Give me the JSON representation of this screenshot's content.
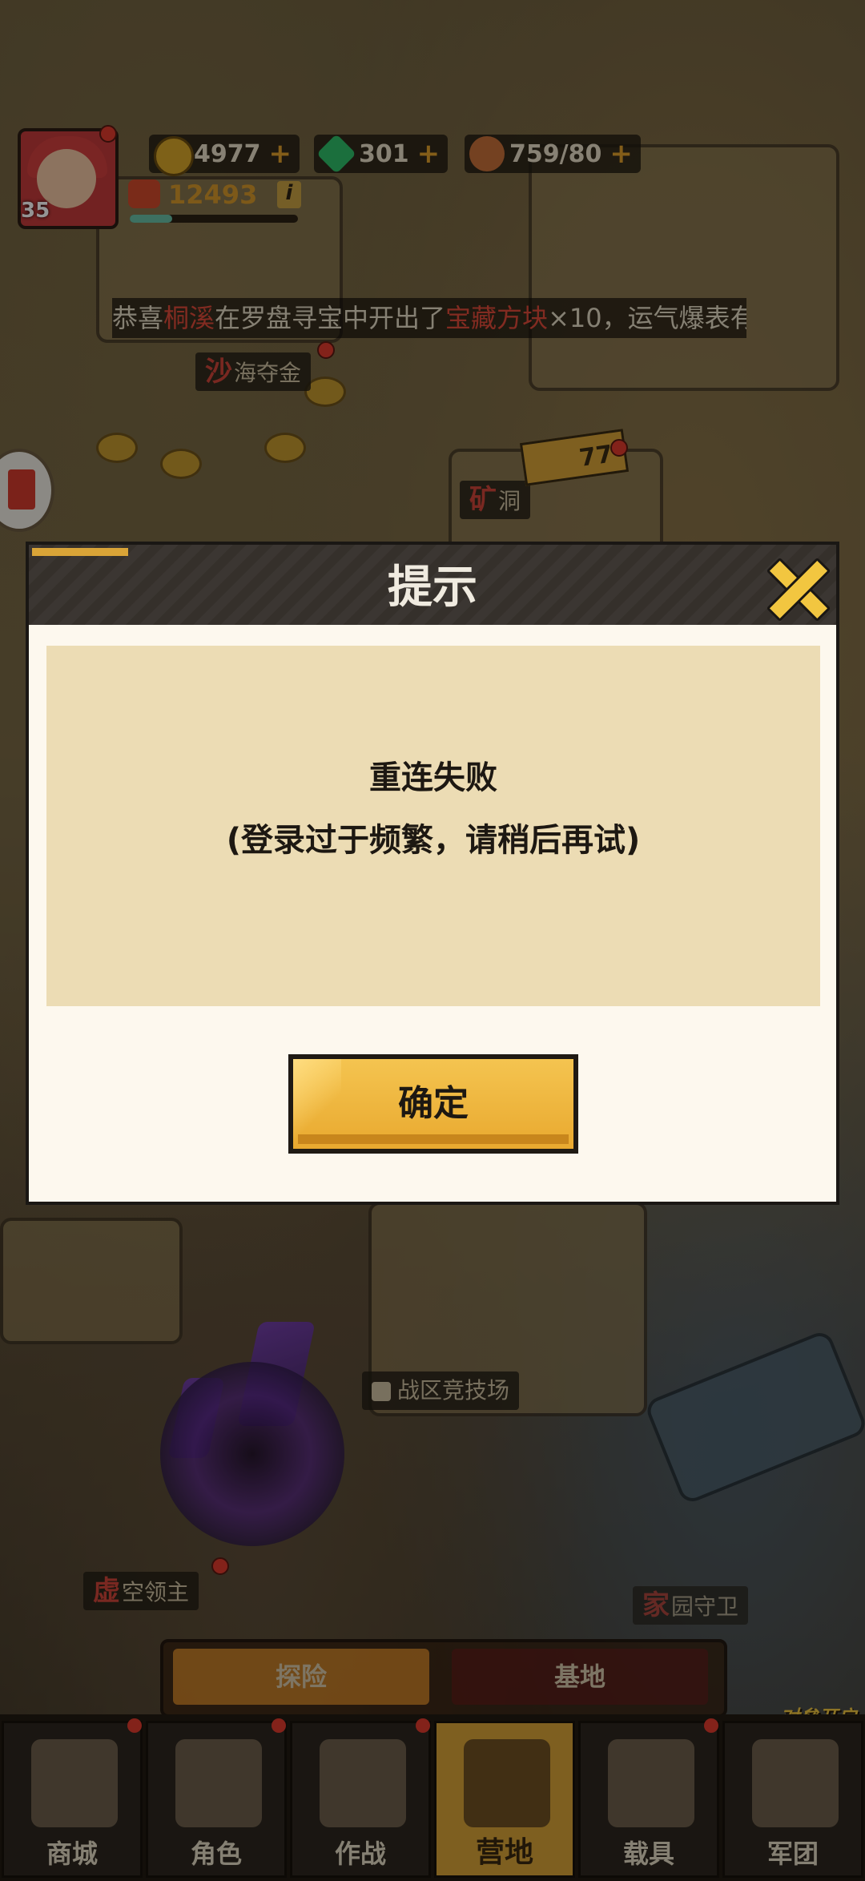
{
  "hud": {
    "level": "35",
    "gold": "4977",
    "gems": "301",
    "stamina": "759/80",
    "power": "12493",
    "plus_symbol": "+",
    "info_symbol": "i",
    "xp_fraction": 0.25
  },
  "ticker": {
    "prefix": "恭喜",
    "player": "桐溪",
    "middle": "在罗盘寻宝中开出了",
    "item": "宝藏方块",
    "suffix": "×10，运气爆表有"
  },
  "map_signs": {
    "sand": {
      "first": "沙",
      "rest": "海夺金"
    },
    "mine": {
      "first": "矿",
      "rest": "洞"
    },
    "pickaxe_count": "77",
    "arena": "战区竞技场",
    "void": {
      "first": "虚",
      "rest": "空领主"
    },
    "home": {
      "first": "家",
      "rest": "园守卫"
    }
  },
  "modal": {
    "title": "提示",
    "message_line1": "重连失败",
    "message_line2": "(登录过于频繁，请稍后再试)",
    "confirm_label": "确定"
  },
  "mode_tabs": [
    "探险",
    "基地"
  ],
  "bottom_nav": [
    {
      "label": "商城",
      "icon": "cart-icon"
    },
    {
      "label": "角色",
      "icon": "hero-icon"
    },
    {
      "label": "作战",
      "icon": "guns-icon"
    },
    {
      "label": "营地",
      "icon": "tent-icon",
      "active": true
    },
    {
      "label": "载具",
      "icon": "robot-arm-icon"
    },
    {
      "label": "军团",
      "icon": "shield-icon"
    }
  ],
  "promo": "对垒开启",
  "colors": {
    "accent": "#d9a437",
    "highlight_red": "#e04b3a",
    "modal_header": "#35302b",
    "message_box": "#ecdcb4"
  }
}
